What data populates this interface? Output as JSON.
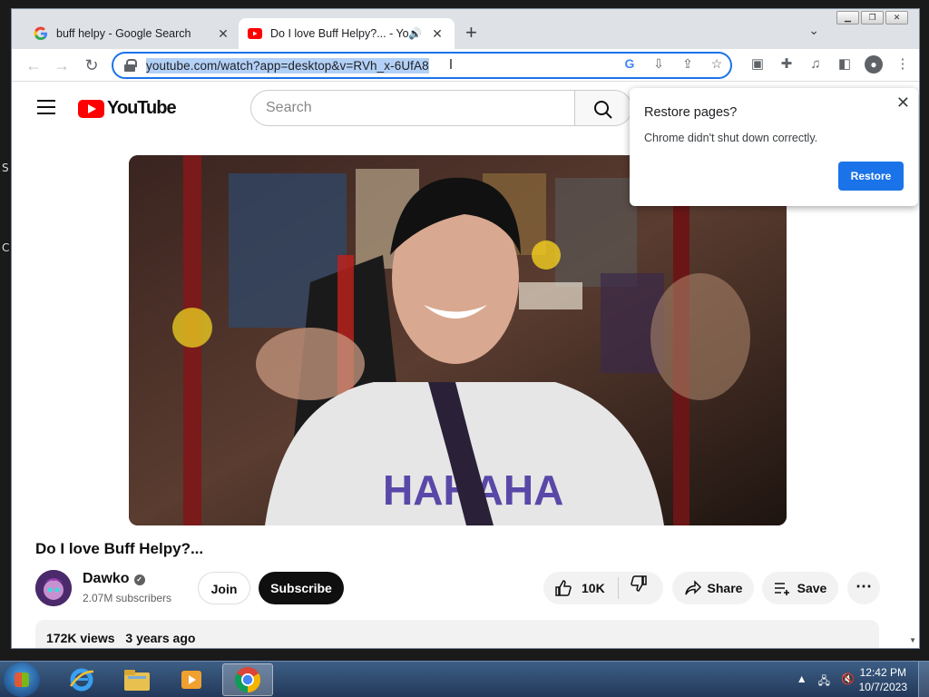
{
  "desktop": {
    "glyph1": "S",
    "glyph2": "C"
  },
  "tabs": [
    {
      "title": "buff helpy - Google Search",
      "favicon": "google-icon",
      "active": false
    },
    {
      "title": "Do I love Buff Helpy?... - You",
      "favicon": "youtube-icon",
      "active": true,
      "audio": true
    }
  ],
  "toolbar": {
    "url": "youtube.com/watch?app=desktop&v=RVh_x-6UfA8",
    "icons": [
      "google-lens-icon",
      "install-icon",
      "share-icon",
      "bookmark-star-icon",
      "picture-in-picture-icon",
      "extensions-icon",
      "media-control-icon",
      "side-panel-icon",
      "profile-icon",
      "menu-icon"
    ]
  },
  "youtube": {
    "logo_text": "YouTube",
    "search_placeholder": "Search",
    "video_title": "Do I love Buff Helpy?...",
    "channel": {
      "name": "Dawko",
      "subscribers": "2.07M subscribers"
    },
    "buttons": {
      "join": "Join",
      "subscribe": "Subscribe",
      "likes": "10K",
      "share": "Share",
      "save": "Save"
    },
    "description": {
      "views": "172K views",
      "age": "3 years ago"
    }
  },
  "restore_popup": {
    "title": "Restore pages?",
    "message": "Chrome didn't shut down correctly.",
    "button": "Restore"
  },
  "taskbar": {
    "apps": [
      "internet-explorer-icon",
      "file-explorer-icon",
      "media-player-icon",
      "chrome-icon"
    ],
    "time": "12:42 PM",
    "date": "10/7/2023"
  },
  "colors": {
    "accent": "#1a73e8",
    "youtube_red": "#ff0000",
    "selection": "#b3d0f7"
  }
}
